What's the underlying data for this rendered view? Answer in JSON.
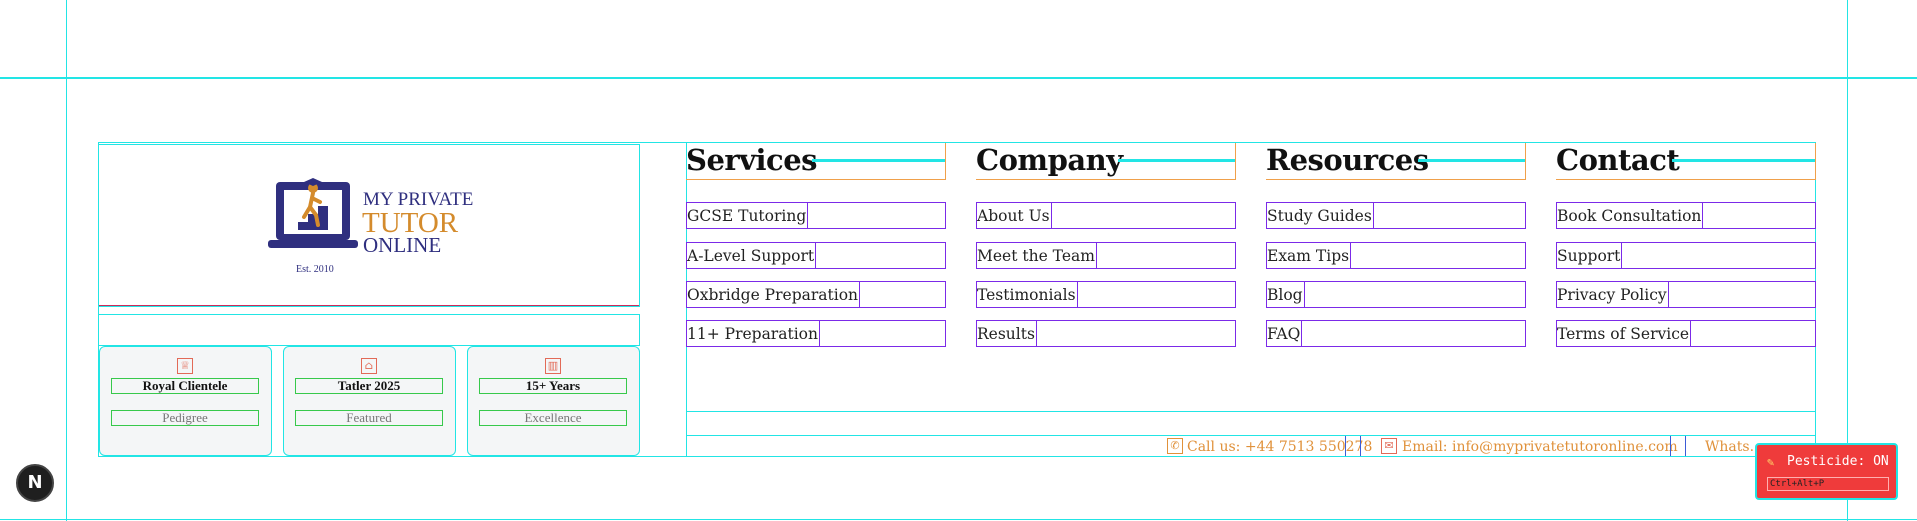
{
  "logo": {
    "line1": "MY PRIVATE",
    "line2": "TUTOR",
    "line3": "ONLINE",
    "est": "Est. 2010",
    "colors": {
      "navy": "#2f2f7f",
      "gold": "#d48b2c"
    }
  },
  "badges": [
    {
      "icon": "crown-icon",
      "glyph": "♕",
      "title": "Royal Clientele",
      "sub": "Pedigree"
    },
    {
      "icon": "building-icon",
      "glyph": "⌂",
      "title": "Tatler 2025",
      "sub": "Featured"
    },
    {
      "icon": "bar-chart-icon",
      "glyph": "▥",
      "title": "15+ Years",
      "sub": "Excellence"
    }
  ],
  "columns": [
    {
      "heading": "Services",
      "links": [
        "GCSE Tutoring",
        "A-Level Support",
        "Oxbridge Preparation",
        "11+ Preparation"
      ]
    },
    {
      "heading": "Company",
      "links": [
        "About Us",
        "Meet the Team",
        "Testimonials",
        "Results"
      ]
    },
    {
      "heading": "Resources",
      "links": [
        "Study Guides",
        "Exam Tips",
        "Blog",
        "FAQ"
      ]
    },
    {
      "heading": "Contact",
      "links": [
        "Book Consultation",
        "Support",
        "Privacy Policy",
        "Terms of Service"
      ]
    }
  ],
  "contact_bar": {
    "phone": "Call us: +44 7513 550278",
    "email": "Email: info@myprivatetutoronline.com",
    "whatsapp": "Whats..."
  },
  "dev": {
    "next_badge": "N",
    "pesticide_label": "Pesticide: ON",
    "pesticide_shortcut": "Ctrl+Alt+P"
  }
}
